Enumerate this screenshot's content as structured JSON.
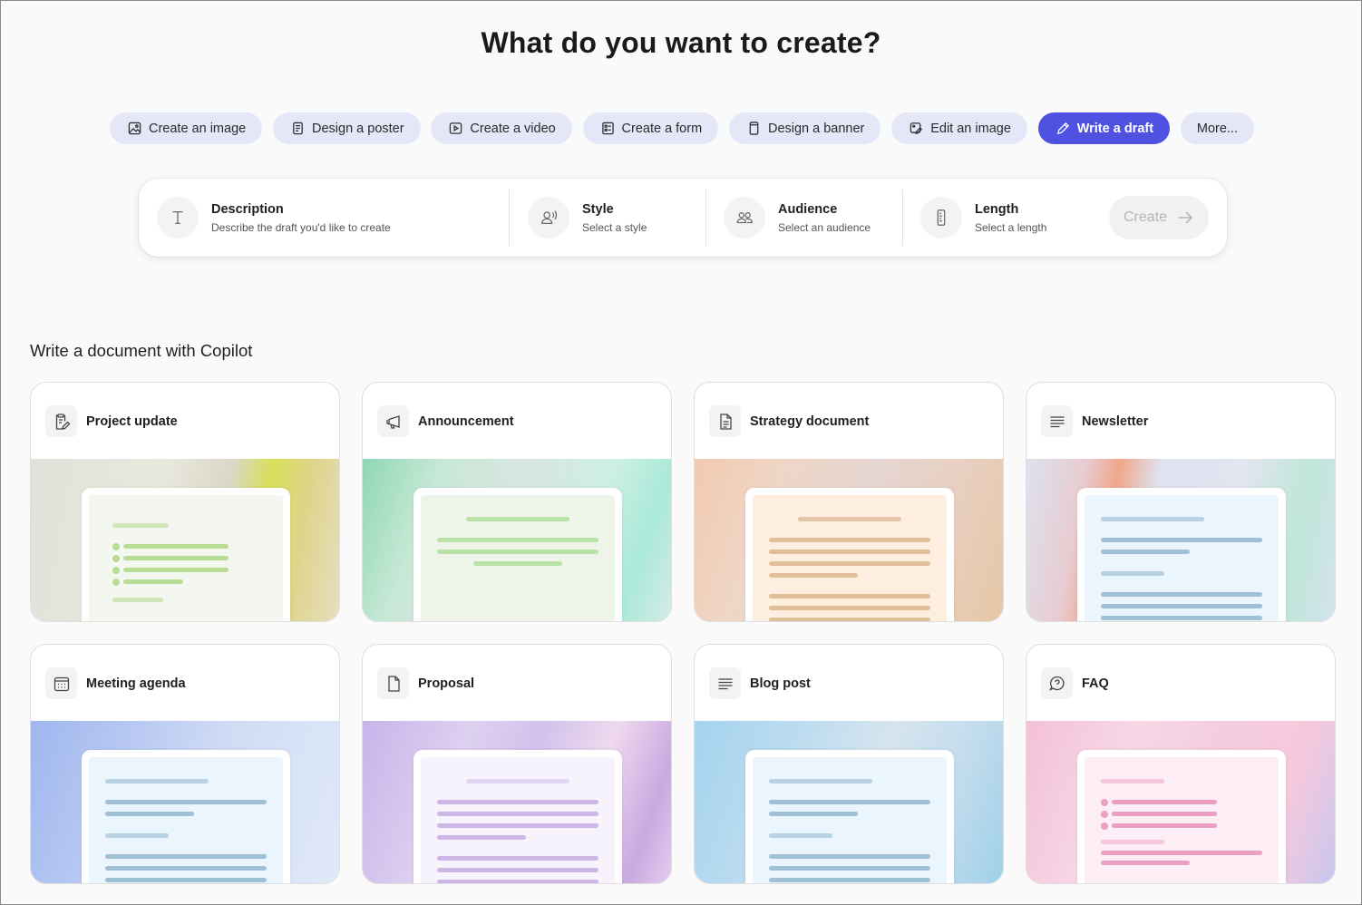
{
  "page": {
    "title": "What do you want to create?"
  },
  "chips": [
    {
      "label": "Create an image",
      "icon": "image-icon"
    },
    {
      "label": "Design a poster",
      "icon": "poster-icon"
    },
    {
      "label": "Create a video",
      "icon": "video-icon"
    },
    {
      "label": "Create a form",
      "icon": "form-icon"
    },
    {
      "label": "Design a banner",
      "icon": "banner-icon"
    },
    {
      "label": "Edit an image",
      "icon": "edit-image-icon"
    },
    {
      "label": "Write a draft",
      "icon": "pen-icon",
      "active": true
    },
    {
      "label": "More..."
    }
  ],
  "prompt": {
    "description": {
      "title": "Description",
      "sub": "Describe the draft you'd like to create",
      "icon": "text-icon"
    },
    "style": {
      "title": "Style",
      "sub": "Select a style",
      "icon": "voice-icon"
    },
    "audience": {
      "title": "Audience",
      "sub": "Select an audience",
      "icon": "people-icon"
    },
    "length": {
      "title": "Length",
      "sub": "Select a length",
      "icon": "ruler-icon"
    },
    "create_label": "Create"
  },
  "section": {
    "title": "Write a document with Copilot"
  },
  "cards": [
    {
      "title": "Project update",
      "icon": "clipboard-edit-icon"
    },
    {
      "title": "Announcement",
      "icon": "megaphone-icon"
    },
    {
      "title": "Strategy document",
      "icon": "document-icon"
    },
    {
      "title": "Newsletter",
      "icon": "lines-icon"
    },
    {
      "title": "Meeting agenda",
      "icon": "calendar-icon"
    },
    {
      "title": "Proposal",
      "icon": "page-icon"
    },
    {
      "title": "Blog post",
      "icon": "lines-icon"
    },
    {
      "title": "FAQ",
      "icon": "chat-question-icon"
    }
  ],
  "colors": {
    "accent": "#4f52e0",
    "chip": "#e4e7f7"
  }
}
